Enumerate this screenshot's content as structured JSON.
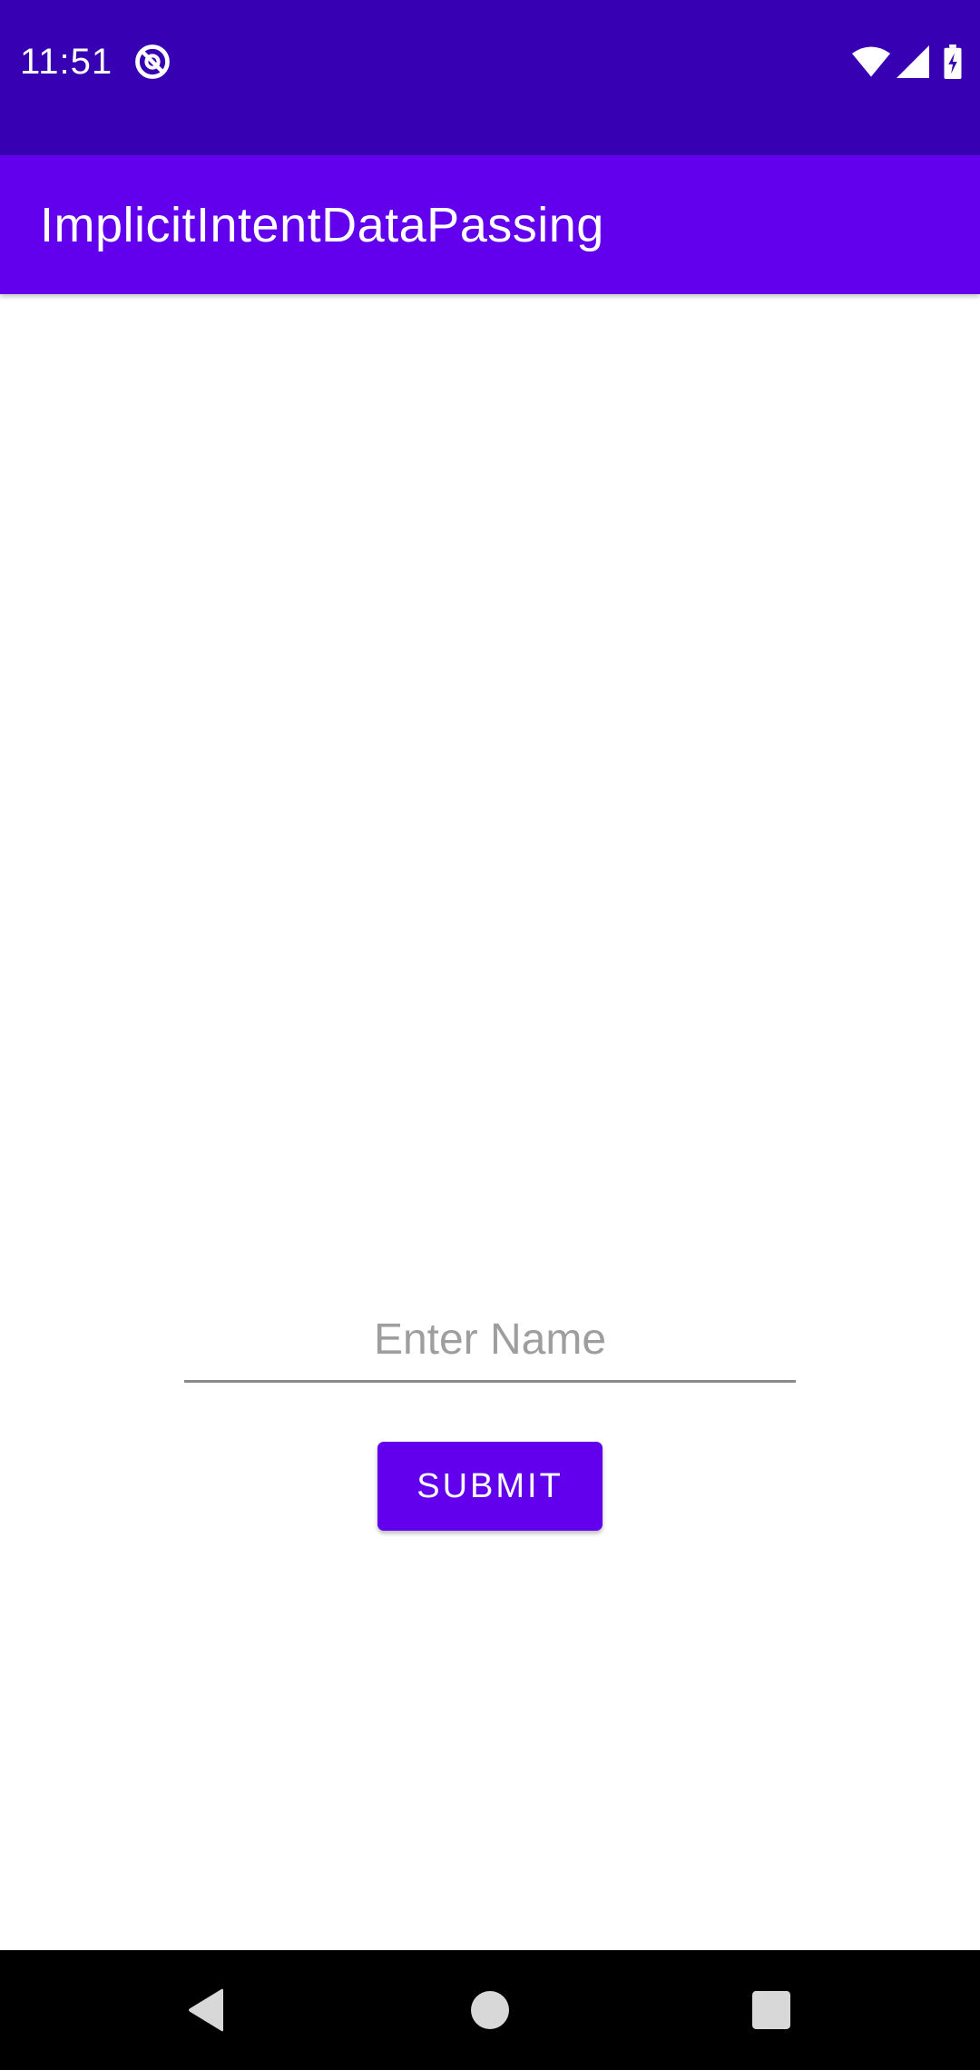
{
  "status_bar": {
    "time": "11:51",
    "icons": [
      "do-not-disturb-icon",
      "wifi-icon",
      "signal-icon",
      "battery-charging-icon"
    ]
  },
  "app_bar": {
    "title": "ImplicitIntentDataPassing"
  },
  "form": {
    "name_input": {
      "value": "",
      "placeholder": "Enter Name"
    },
    "submit_label": "SUBMIT"
  },
  "nav_bar": {
    "icons": [
      "back-icon",
      "home-icon",
      "recents-icon"
    ]
  },
  "colors": {
    "status_bar": "#3700B3",
    "primary": "#6200EE",
    "background": "#FFFFFF",
    "nav_bar": "#000000"
  }
}
